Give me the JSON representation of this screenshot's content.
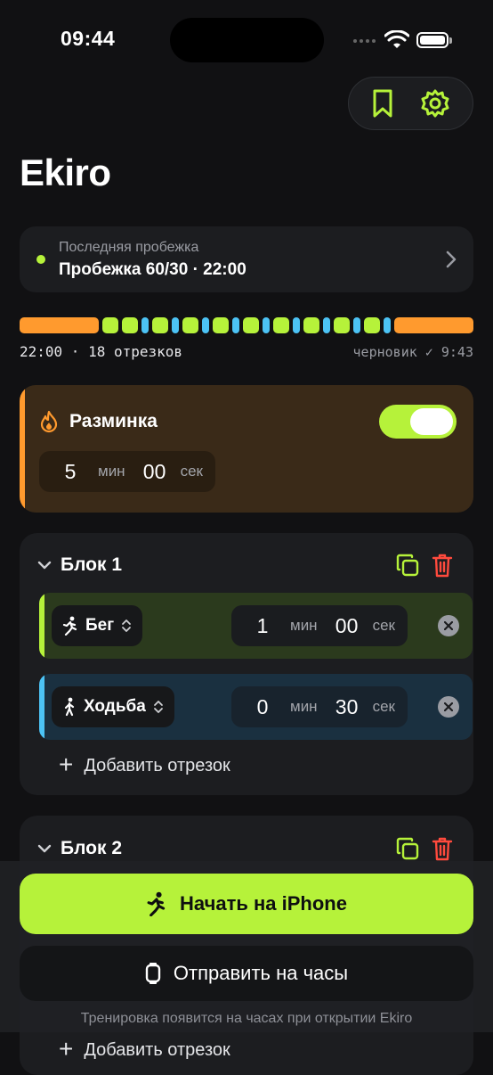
{
  "status": {
    "time": "09:44"
  },
  "header": {
    "title": "Ekiro"
  },
  "last_run": {
    "label": "Последняя пробежка",
    "value": "Пробежка 60/30 · 22:00"
  },
  "timeline": {
    "segments": [
      "warm",
      "run",
      "run",
      "walk",
      "run",
      "walk",
      "run",
      "walk",
      "run",
      "walk",
      "run",
      "walk",
      "run",
      "walk",
      "run",
      "walk",
      "run",
      "walk",
      "run",
      "walk",
      "cool"
    ],
    "left_text": "22:00 · 18 отрезков",
    "right_text": "черновик ✓ 9:43",
    "colors": {
      "warm": "#ff9a2e",
      "run": "#b6f23a",
      "walk": "#4cc3f5",
      "cool": "#ff9a2e"
    }
  },
  "warmup": {
    "title": "Разминка",
    "enabled": true,
    "minutes": "5",
    "min_unit": "мин",
    "seconds": "00",
    "sec_unit": "сек"
  },
  "blocks": [
    {
      "title": "Блок 1",
      "segments": [
        {
          "type": "Бег",
          "minutes": "1",
          "min_unit": "мин",
          "seconds": "00",
          "sec_unit": "сек",
          "color": "#b6f23a"
        },
        {
          "type": "Ходьба",
          "minutes": "0",
          "min_unit": "мин",
          "seconds": "30",
          "sec_unit": "сек",
          "color": "#4cc3f5"
        }
      ],
      "add_label": "Добавить отрезок"
    },
    {
      "title": "Блок 2",
      "add_label": "Добавить отрезок"
    }
  ],
  "actions": {
    "start_label": "Начать на iPhone",
    "watch_label": "Отправить на часы",
    "hint": "Тренировка появится на часах при открытии Ekiro"
  },
  "colors": {
    "accent": "#b6f23a",
    "orange": "#ff9a2e",
    "blue": "#4cc3f5",
    "danger": "#ff4a3d"
  }
}
